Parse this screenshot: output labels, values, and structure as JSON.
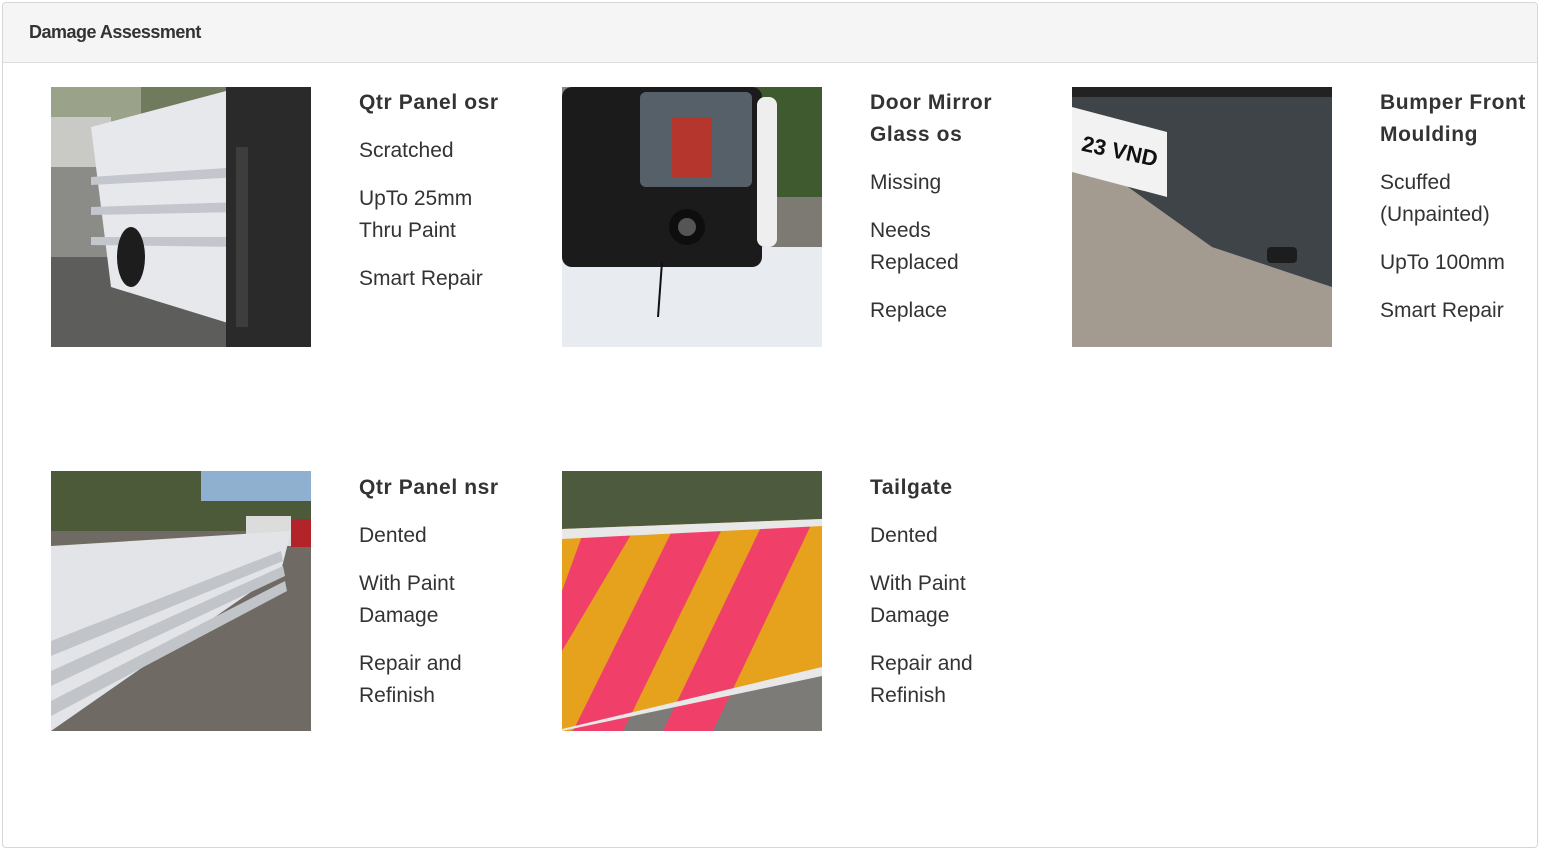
{
  "panel": {
    "title": "Damage Assessment"
  },
  "items": [
    {
      "title": "Qtr Panel osr",
      "damage": "Scratched",
      "size": "UpTo 25mm Thru Paint",
      "action": "Smart Repair"
    },
    {
      "title": "Door Mirror Glass os",
      "damage": "Missing",
      "size": "Needs Replaced",
      "action": "Replace"
    },
    {
      "title": "Bumper Front Moulding",
      "damage": "Scuffed (Unpainted)",
      "size": "UpTo 100mm",
      "action": "Smart Repair"
    },
    {
      "title": "Qtr Panel nsr",
      "damage": "Dented",
      "size": "With Paint Damage",
      "action": "Repair and Refinish"
    },
    {
      "title": "Tailgate",
      "damage": "Dented",
      "size": "With Paint Damage",
      "action": "Repair and Refinish"
    }
  ],
  "photo_plate_text": "23 VND"
}
